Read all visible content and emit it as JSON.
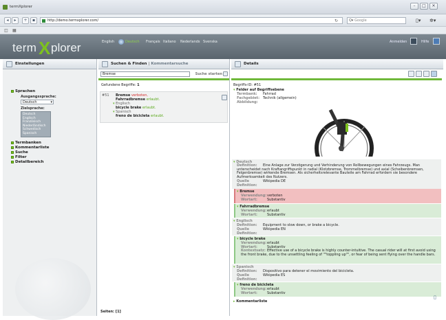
{
  "window": {
    "title": "termXplorer"
  },
  "browser": {
    "url": "http://demo.termxplorer.com/",
    "search_placeholder": "Google"
  },
  "brand": {
    "part1": "term",
    "x": "X",
    "part2": "plorer"
  },
  "languages": [
    "English",
    "Deutsch",
    "Français",
    "Italiano",
    "Nederlands",
    "Svenska"
  ],
  "active_language_index": 1,
  "header": {
    "login": "Anmelden",
    "help": "Hilfe"
  },
  "left": {
    "tab": "Einstellungen",
    "sprachen": "Sprachen",
    "ausgang_label": "Ausgangssprache:",
    "ausgang_value": "Deutsch",
    "ziel_label": "Zielsprache:",
    "ziel_options": [
      "Deutsch",
      "Englisch",
      "Französisch",
      "Niederländisch",
      "Schwedisch",
      "Spanisch"
    ],
    "sections": [
      "Termbanken",
      "Kommentarliste",
      "Suche",
      "Filter",
      "Detailbereich"
    ]
  },
  "mid": {
    "tab": "Suchen & Finden",
    "tab_sep": "|",
    "tab2": "Kommentarsuche",
    "search_value": "Bremse",
    "search_button": "Suche starten",
    "found_label": "Gefundene Begriffe:",
    "found_count": "1",
    "id": "#51",
    "t1": "Bremse",
    "t1s": "verboten,",
    "t2": "Fahrradbremse",
    "t2s": "erlaubt.",
    "lang_en": "Englisch",
    "t3": "bicycle brake",
    "t3s": "erlaubt.",
    "lang_es": "Spanisch",
    "t4": "freno de bicicleta",
    "t4s": "erlaubt.",
    "pages": "Seiten: [1]"
  },
  "right": {
    "tab": "Details",
    "begriff_id": "Begriffs-ID: #51",
    "felder": "Felder auf Begriffsebene",
    "termbank_l": "Termbank:",
    "termbank_v": "Fahrrad",
    "fach_l": "Fachgebiet:",
    "fach_v": "Technik (allgemein)",
    "abb_l": "Abbildung:",
    "deutsch": "Deutsch",
    "def_l": "Definition:",
    "def_de": "Eine Anlage zur Verzögerung und Verhinderung von Rollbewegungen eines Fahrzeugs. Man unterscheidet nach Kraftangriffspunkt in radial (Klotzbremse, Trommelbremse) und axial (Scheibenbremsen, Felgenbremse) wirkende Bremsen. Als sicherheitsrelevante Bauteile am Fahrrad erfordern sie besondere Aufmerksamkeit des Nutzers.",
    "quelle_l": "Quelle",
    "quelle_de": "Wikipedia DE",
    "def2_l": "Definition:",
    "bremse": "Bremse",
    "verw_l": "Verwendung:",
    "wortart_l": "Wortart:",
    "bremse_v": "verboten",
    "bremse_w": "Substantiv",
    "fahrrad": "Fahrradbremse",
    "fahrrad_v": "erlaubt",
    "fahrrad_w": "Substantiv",
    "englisch": "Englisch",
    "def_en": "Equipment to slow down, or brake a bicycle.",
    "quelle_en": "Wikipedia EN",
    "bb": "bicycle brake",
    "bb_v": "erlaubt",
    "bb_w": "Substantiv",
    "kontext_l": "Kontextsatz:",
    "bb_k": "Effective use of a bicycle brake is highly counter-intuitive. The casual rider will at first avoid using the front brake, due to the unsettling feeling of \"\"toppling up\"\", or fear of being sent flying over the handle bars.",
    "spanisch": "Spanisch",
    "def_es": "Dispositivo para detener el movimiento del bicicleta.",
    "quelle_es": "Wikipedia ES",
    "fb": "freno de bicicleta",
    "fb_v": "erlaubt",
    "fb_w": "Substantiv",
    "kommentar": "Kommentarliste"
  },
  "colors": {
    "accent_green": "#7dc21e",
    "header_gray": "#66717a",
    "red_box": "#f2bfc0",
    "green_box": "#d9ecd7"
  }
}
